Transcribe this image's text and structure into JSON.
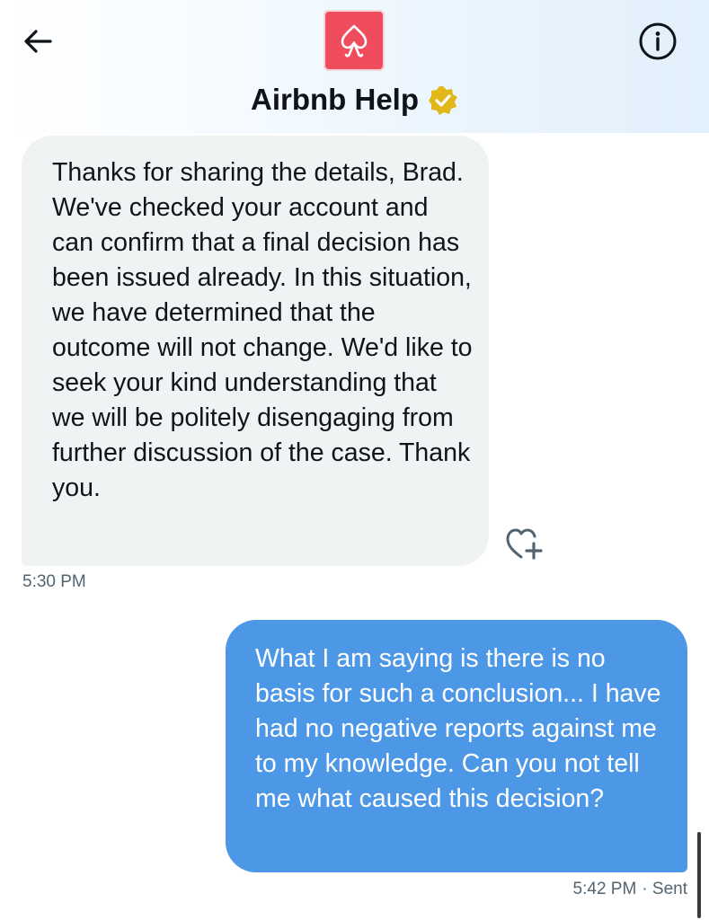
{
  "header": {
    "title": "Airbnb Help",
    "back_icon": "arrow-left-icon",
    "info_icon": "info-icon",
    "avatar_icon": "airbnb-logo-icon",
    "verified_icon": "verified-badge-icon",
    "avatar_color": "#ef4d5e",
    "badge_color": "#e2b719"
  },
  "messages": [
    {
      "direction": "incoming",
      "text": "Thanks for sharing the details, Brad. We've checked your account and can confirm that a final decision has been issued already. In this situation, we have determined that the outcome will not change. We'd like to seek your kind understanding that we will be politely disengaging from further discussion of the case. Thank you.",
      "time": "5:30 PM",
      "react_icon": "heart-plus-icon",
      "bubble_color": "#eff3f4"
    },
    {
      "direction": "outgoing",
      "text": "What I am saying is there is no basis for such a conclusion... I have had no negative reports against me to my knowledge. Can you not tell me what caused this decision?",
      "time": "5:42 PM",
      "status": "· Sent",
      "bubble_color": "#4c97e6"
    }
  ]
}
